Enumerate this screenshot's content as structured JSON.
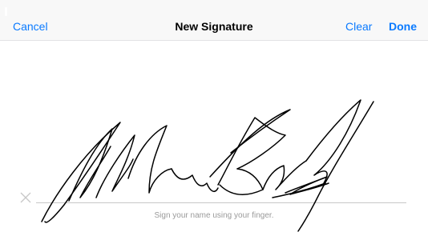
{
  "navbar": {
    "cancel_label": "Cancel",
    "title": "New Signature",
    "clear_label": "Clear",
    "done_label": "Done"
  },
  "canvas": {
    "hint": "Sign your name using your finger.",
    "x_mark_icon": "x-mark-icon"
  },
  "colors": {
    "accent": "#0a7aff",
    "ink": "#000000",
    "baseline": "#c8c8c8",
    "hint": "#9a9a9a"
  }
}
